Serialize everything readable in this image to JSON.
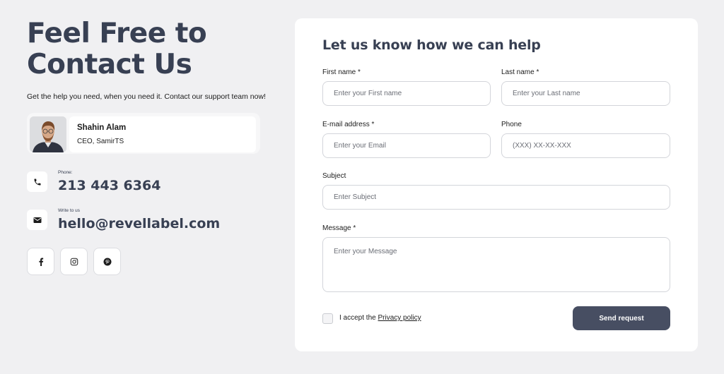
{
  "hero": {
    "title_line1": "Feel Free to",
    "title_line2": "Contact Us",
    "subtitle": "Get the help you need, when you need it. Contact our support team now!"
  },
  "person": {
    "name": "Shahin Alam",
    "role": "CEO, SamirTS"
  },
  "contacts": {
    "phone_label": "Phone:",
    "phone_value": "213 443 6364",
    "email_label": "Write to us",
    "email_value": "hello@revellabel.com"
  },
  "socials": {
    "icons": [
      "facebook-icon",
      "instagram-icon",
      "pinterest-icon"
    ]
  },
  "form": {
    "title": "Let us know how we can help",
    "first_name": {
      "label": "First name *",
      "placeholder": "Enter your First name",
      "value": ""
    },
    "last_name": {
      "label": "Last name *",
      "placeholder": "Enter your Last name",
      "value": ""
    },
    "email": {
      "label": "E-mail address *",
      "placeholder": "Enter your Email",
      "value": ""
    },
    "phone": {
      "label": "Phone",
      "placeholder": "(XXX) XX-XX-XXX",
      "value": ""
    },
    "subject": {
      "label": "Subject",
      "placeholder": "Enter Subject",
      "value": ""
    },
    "message": {
      "label": "Message *",
      "placeholder": "Enter your Message",
      "value": ""
    },
    "accept_prefix": "I accept the",
    "accept_link": "Privacy policy",
    "accept_checked": false,
    "submit_label": "Send request"
  },
  "colors": {
    "page_background": "#f0f0f2",
    "heading": "#384053",
    "button": "#474e62",
    "card": "#ffffff"
  }
}
